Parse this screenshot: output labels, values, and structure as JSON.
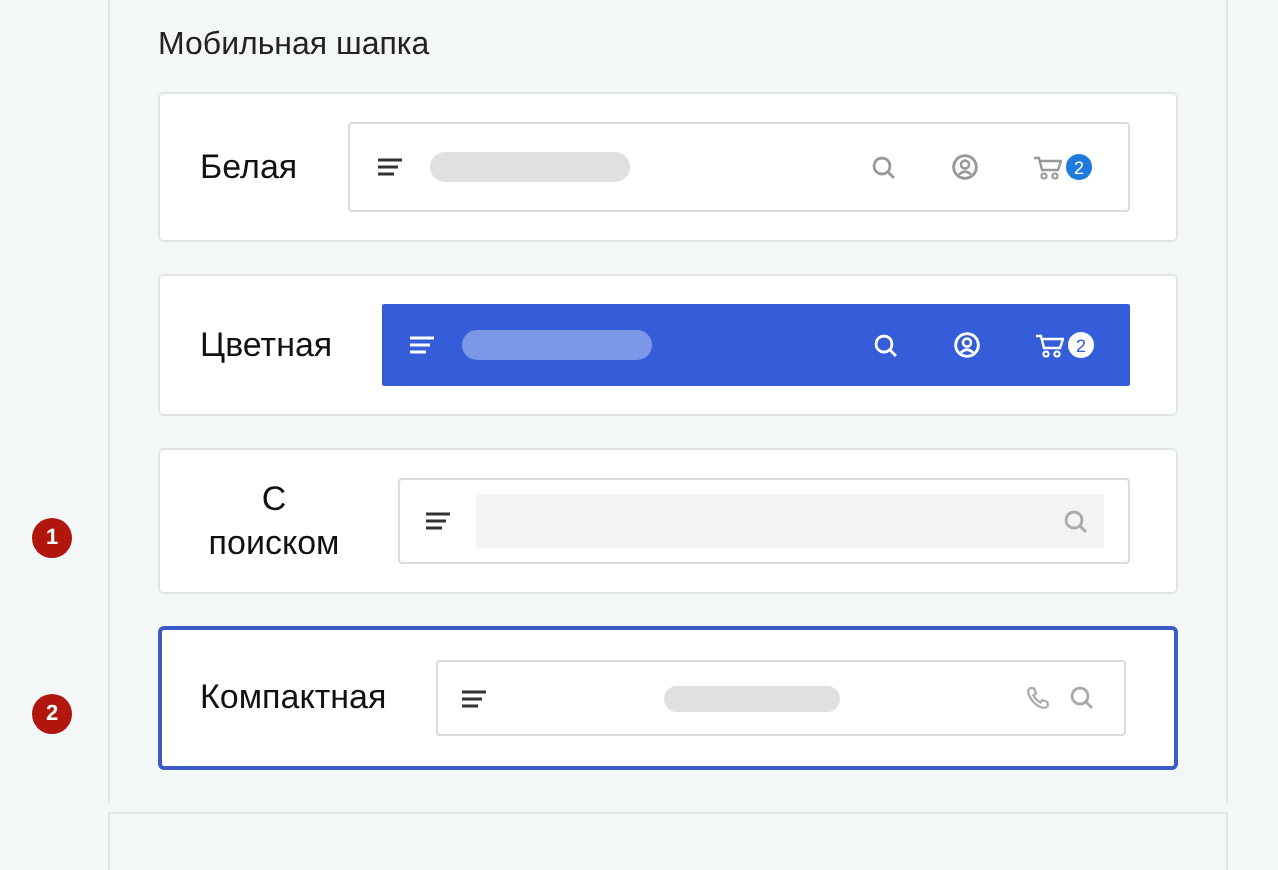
{
  "section_title": "Мобильная шапка",
  "options": [
    {
      "kind": "white",
      "label": "Белая",
      "selected": false,
      "cart_count": "2"
    },
    {
      "kind": "colored",
      "label": "Цветная",
      "selected": false,
      "cart_count": "2"
    },
    {
      "kind": "search",
      "label": "С поиском",
      "selected": false,
      "marker": "1"
    },
    {
      "kind": "compact",
      "label": "Компактная",
      "selected": true,
      "marker": "2"
    }
  ]
}
